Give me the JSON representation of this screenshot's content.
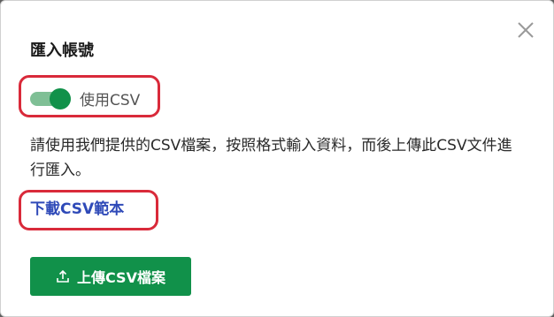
{
  "dialog": {
    "title": "匯入帳號",
    "close_icon": "close-icon",
    "toggle": {
      "label": "使用CSV",
      "on": true,
      "color": "#11914a"
    },
    "description": "請使用我們提供的CSV檔案，按照格式輸入資料，而後上傳此CSV文件進行匯入。",
    "download_link": "下載CSV範本",
    "upload_button": {
      "label": "上傳CSV檔案",
      "icon": "upload-icon"
    }
  },
  "colors": {
    "accent": "#11914a",
    "link": "#2f4ab8",
    "highlight": "#d92a3a"
  }
}
